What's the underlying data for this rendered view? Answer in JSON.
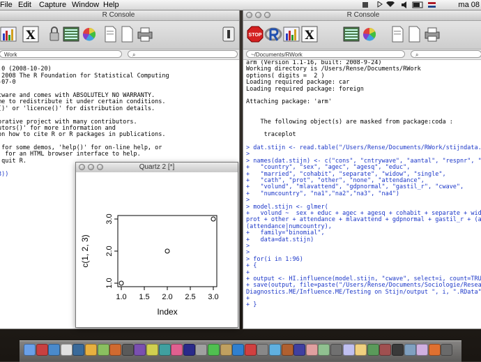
{
  "menubar": {
    "items": [
      "File",
      "Edit",
      "Capture",
      "Window",
      "Help"
    ],
    "clock": "ma 08"
  },
  "left_window": {
    "title": "R Console",
    "path": "Work",
    "console_lines": [
      {
        "t": "",
        "c": "out"
      },
      {
        "t": ".0 (2008-10-20)",
        "c": "out"
      },
      {
        "t": " 2008 The R Foundation for Statistical Computing",
        "c": "out"
      },
      {
        "t": "-07-0",
        "c": "out"
      },
      {
        "t": "",
        "c": "out"
      },
      {
        "t": "tware and comes with ABSOLUTELY NO WARRANTY.",
        "c": "out"
      },
      {
        "t": "me to redistribute it under certain conditions.",
        "c": "out"
      },
      {
        "t": "()' or 'licence()' for distribution details.",
        "c": "out"
      },
      {
        "t": "",
        "c": "out"
      },
      {
        "t": "orative project with many contributors.",
        "c": "out"
      },
      {
        "t": "utors()' for more information and",
        "c": "out"
      },
      {
        "t": "on how to cite R or R packages in publications.",
        "c": "out"
      },
      {
        "t": "",
        "c": "out"
      },
      {
        "t": " for some demos, 'help()' for on-line help, or",
        "c": "out"
      },
      {
        "t": "' for an HTML browser interface to help.",
        "c": "out"
      },
      {
        "t": " quit R.",
        "c": "out"
      },
      {
        "t": "",
        "c": "out"
      },
      {
        "t": "3))",
        "c": "in"
      }
    ]
  },
  "right_window": {
    "title": "R Console",
    "path": "~/Documents/RWork",
    "console_lines": [
      {
        "t": "arm (Version 1.1-16, built: 2008-9-24)",
        "c": "out"
      },
      {
        "t": "Working directory is /Users/Rense/Documents/RWork",
        "c": "out"
      },
      {
        "t": "options( digits =  2 )",
        "c": "out"
      },
      {
        "t": "Loading required package: car",
        "c": "out"
      },
      {
        "t": "Loading required package: foreign",
        "c": "out"
      },
      {
        "t": "",
        "c": "out"
      },
      {
        "t": "Attaching package: 'arm'",
        "c": "out"
      },
      {
        "t": "",
        "c": "out"
      },
      {
        "t": "",
        "c": "out"
      },
      {
        "t": "    The following object(s) are masked from package:coda :",
        "c": "out"
      },
      {
        "t": "",
        "c": "out"
      },
      {
        "t": "     traceplot",
        "c": "out"
      },
      {
        "t": "",
        "c": "out"
      },
      {
        "t": "> dat.stijn <- read.table(\"/Users/Rense/Documents/RWork/stijndata.txt\")",
        "c": "in"
      },
      {
        "t": ">",
        "c": "in"
      },
      {
        "t": "> names(dat.stijn) <- c(\"cons\", \"cntrywave\", \"aantal\", \"respnr\", \"wave\",",
        "c": "in"
      },
      {
        "t": "+   \"country\", \"sex\", \"agec\", \"agesq\", \"educ\",",
        "c": "in"
      },
      {
        "t": "+   \"married\", \"cohabit\", \"separate\", \"widow\", \"single\",",
        "c": "in"
      },
      {
        "t": "+   \"cath\", \"prot\", \"other\", \"none\", \"attendance\",",
        "c": "in"
      },
      {
        "t": "+   \"volund\", \"mlavattend\", \"gdpnormal\", \"gastil_r\", \"cwave\",",
        "c": "in"
      },
      {
        "t": "+   \"numcountry\", \"na1\",\"na2\",\"na3\", \"na4\")",
        "c": "in"
      },
      {
        "t": ">",
        "c": "in"
      },
      {
        "t": "> model.stijn <- glmer(",
        "c": "in"
      },
      {
        "t": "+   volund ~  sex + educ + agec + agesq + cohabit + separate + widow + sing",
        "c": "in"
      },
      {
        "t": "prot + other + attendance + mlavattend + gdpnormal + gastil_r + (attendance",
        "c": "in"
      },
      {
        "t": "(attendance|numcountry),",
        "c": "in"
      },
      {
        "t": "+   family=\"binomial\",",
        "c": "in"
      },
      {
        "t": "+   data=dat.stijn)",
        "c": "in"
      },
      {
        "t": ">",
        "c": "in"
      },
      {
        "t": ">",
        "c": "in"
      },
      {
        "t": "> for(i in 1:96)",
        "c": "in"
      },
      {
        "t": "+ {",
        "c": "in"
      },
      {
        "t": "+",
        "c": "in"
      },
      {
        "t": "+ output <- HI.influence(model.stijn, \"cwave\", select=i, count=TRUE)",
        "c": "in"
      },
      {
        "t": "+ save(output, file=paste(\"/Users/Rense/Documents/Sociologie/Research Maste",
        "c": "in"
      },
      {
        "t": "Diagnostics.ME/Influence.ME/Testing on Stijn/output \", i, \".RData\", sep=\"\")",
        "c": "in"
      },
      {
        "t": "+",
        "c": "in"
      },
      {
        "t": "+ }",
        "c": "in"
      }
    ]
  },
  "quartz": {
    "title": "Quartz 2 [*]"
  },
  "chart_data": {
    "type": "scatter",
    "x": [
      1,
      2,
      3
    ],
    "y": [
      1,
      2,
      3
    ],
    "xlabel": "Index",
    "ylabel": "c(1, 2, 3)",
    "xlim": [
      1,
      3
    ],
    "ylim": [
      1,
      3
    ],
    "xticks": [
      "1.0",
      "1.5",
      "2.0",
      "2.5",
      "3.0"
    ],
    "yticks": [
      "1.0",
      "2.0",
      "3.0"
    ],
    "grid": false
  },
  "icons": {
    "left_toolbar": [
      "bar-chart-icon",
      "x11-icon",
      "lock-icon",
      "console-icon",
      "color-wheel-icon",
      "document-icon",
      "new-document-icon",
      "printer-icon",
      "toggle-icon"
    ],
    "right_toolbar": [
      "stop-icon",
      "r-logo-icon",
      "bar-chart-icon",
      "x11-icon",
      "console-icon",
      "color-wheel-icon",
      "document-icon",
      "new-document-icon",
      "printer-icon"
    ]
  },
  "labels": {
    "x11": "X",
    "stop": "STOP"
  }
}
